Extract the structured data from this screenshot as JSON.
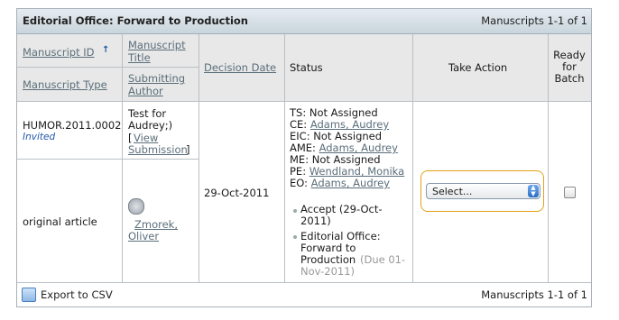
{
  "table": {
    "title": "Editorial Office: Forward to Production",
    "count_top": "Manuscripts 1-1 of 1",
    "count_bottom": "Manuscripts 1-1 of 1",
    "headers": {
      "manuscript_id": "Manuscript ID",
      "sort_arrow": "↑",
      "manuscript_title": "Manuscript Title",
      "manuscript_type": "Manuscript Type",
      "submitting_author": "Submitting Author",
      "decision_date": "Decision Date",
      "status": "Status",
      "take_action": "Take Action",
      "ready_for_batch": "Ready for Batch"
    },
    "row": {
      "id": "HUMOR.2011.0002",
      "invited": "Invited",
      "title_line1": "Test for",
      "title_line2": "Audrey;)",
      "view_open": "[",
      "view_link1": "View",
      "view_link2": "Submission",
      "view_close": "]",
      "type": "original article",
      "author_line1": "Zmorek,",
      "author_line2": "Oliver",
      "decision_date": "29-Oct-2011",
      "status_lines": [
        {
          "label": "TS:",
          "value": "Not Assigned",
          "link": false
        },
        {
          "label": "CE:",
          "value": "Adams, Audrey",
          "link": true
        },
        {
          "label": "EIC:",
          "value": "Not Assigned",
          "link": false
        },
        {
          "label": "AME:",
          "value": "Adams, Audrey",
          "link": true
        },
        {
          "label": "ME:",
          "value": "Not Assigned",
          "link": false
        },
        {
          "label": "PE:",
          "value": "Wendland, Monika",
          "link": true
        },
        {
          "label": "EO:",
          "value": "Adams, Audrey",
          "link": true
        }
      ],
      "history": {
        "accept_1": "Accept (29-Oct-",
        "accept_2": "2011)",
        "eo_1": "Editorial Office:",
        "eo_2": "Forward to",
        "eo_3": "Production",
        "due_1": "(Due 01-",
        "due_2": "Nov-2011)"
      },
      "action_select": "Select...",
      "ready_checked": false
    },
    "export_label": "Export to CSV"
  }
}
